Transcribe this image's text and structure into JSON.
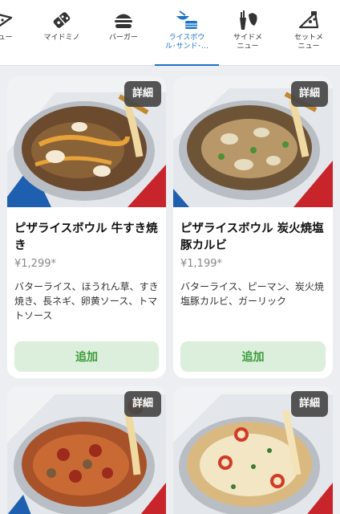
{
  "tabs": [
    {
      "label": "ニュー",
      "icon": "pizza-slice-icon",
      "active": false
    },
    {
      "label": "マイドミノ",
      "icon": "domino-logo-icon",
      "active": false
    },
    {
      "label": "バーガー",
      "icon": "burger-icon",
      "active": false
    },
    {
      "label": "ライスボウ\nル･サンド･…",
      "icon": "rice-bowl-sandwich-icon",
      "active": true
    },
    {
      "label": "サイドメ\nニュー",
      "icon": "side-menu-icon",
      "active": false
    },
    {
      "label": "セットメ\nニュー",
      "icon": "set-menu-icon",
      "active": false
    }
  ],
  "products": [
    {
      "name": "ピザライスボウル 牛すき焼き",
      "price": "¥1,299*",
      "description": "バターライス、ほうれん草、すき焼き、長ネギ、卵黄ソース、トマトソース",
      "detail_label": "詳細",
      "add_label": "追加",
      "image": "beef-sukiyaki-rice-bowl"
    },
    {
      "name": "ピザライスボウル 炭火焼塩豚カルビ",
      "price": "¥1,199*",
      "description": "バターライス、ピーマン、炭火焼塩豚カルビ、ガーリック",
      "detail_label": "詳細",
      "add_label": "追加",
      "image": "pork-kalbi-rice-bowl"
    },
    {
      "detail_label": "詳細",
      "image": "pepperoni-rice-bowl"
    },
    {
      "detail_label": "詳細",
      "image": "margherita-rice-bowl"
    }
  ],
  "colors": {
    "accent": "#1a73c9",
    "add_button_bg": "#dcefdc",
    "add_button_text": "#3a9a3a",
    "page_bg": "#eceef1"
  }
}
